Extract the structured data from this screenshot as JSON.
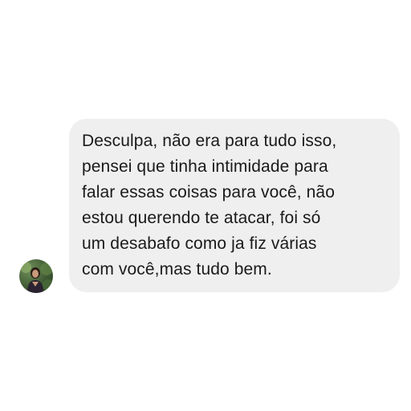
{
  "conversation": {
    "incoming_message": {
      "text": "Desculpa, não era para tudo isso,\npensei que tinha intimidade para\nfalar essas coisas para você, não\nestou querendo te atacar, foi só\num desabafo como ja fiz várias\ncom você,mas tudo bem.",
      "bubble_color": "#efefef",
      "text_color": "#1a1a1a"
    },
    "sender": {
      "avatar_icon": "profile-photo-icon"
    }
  }
}
